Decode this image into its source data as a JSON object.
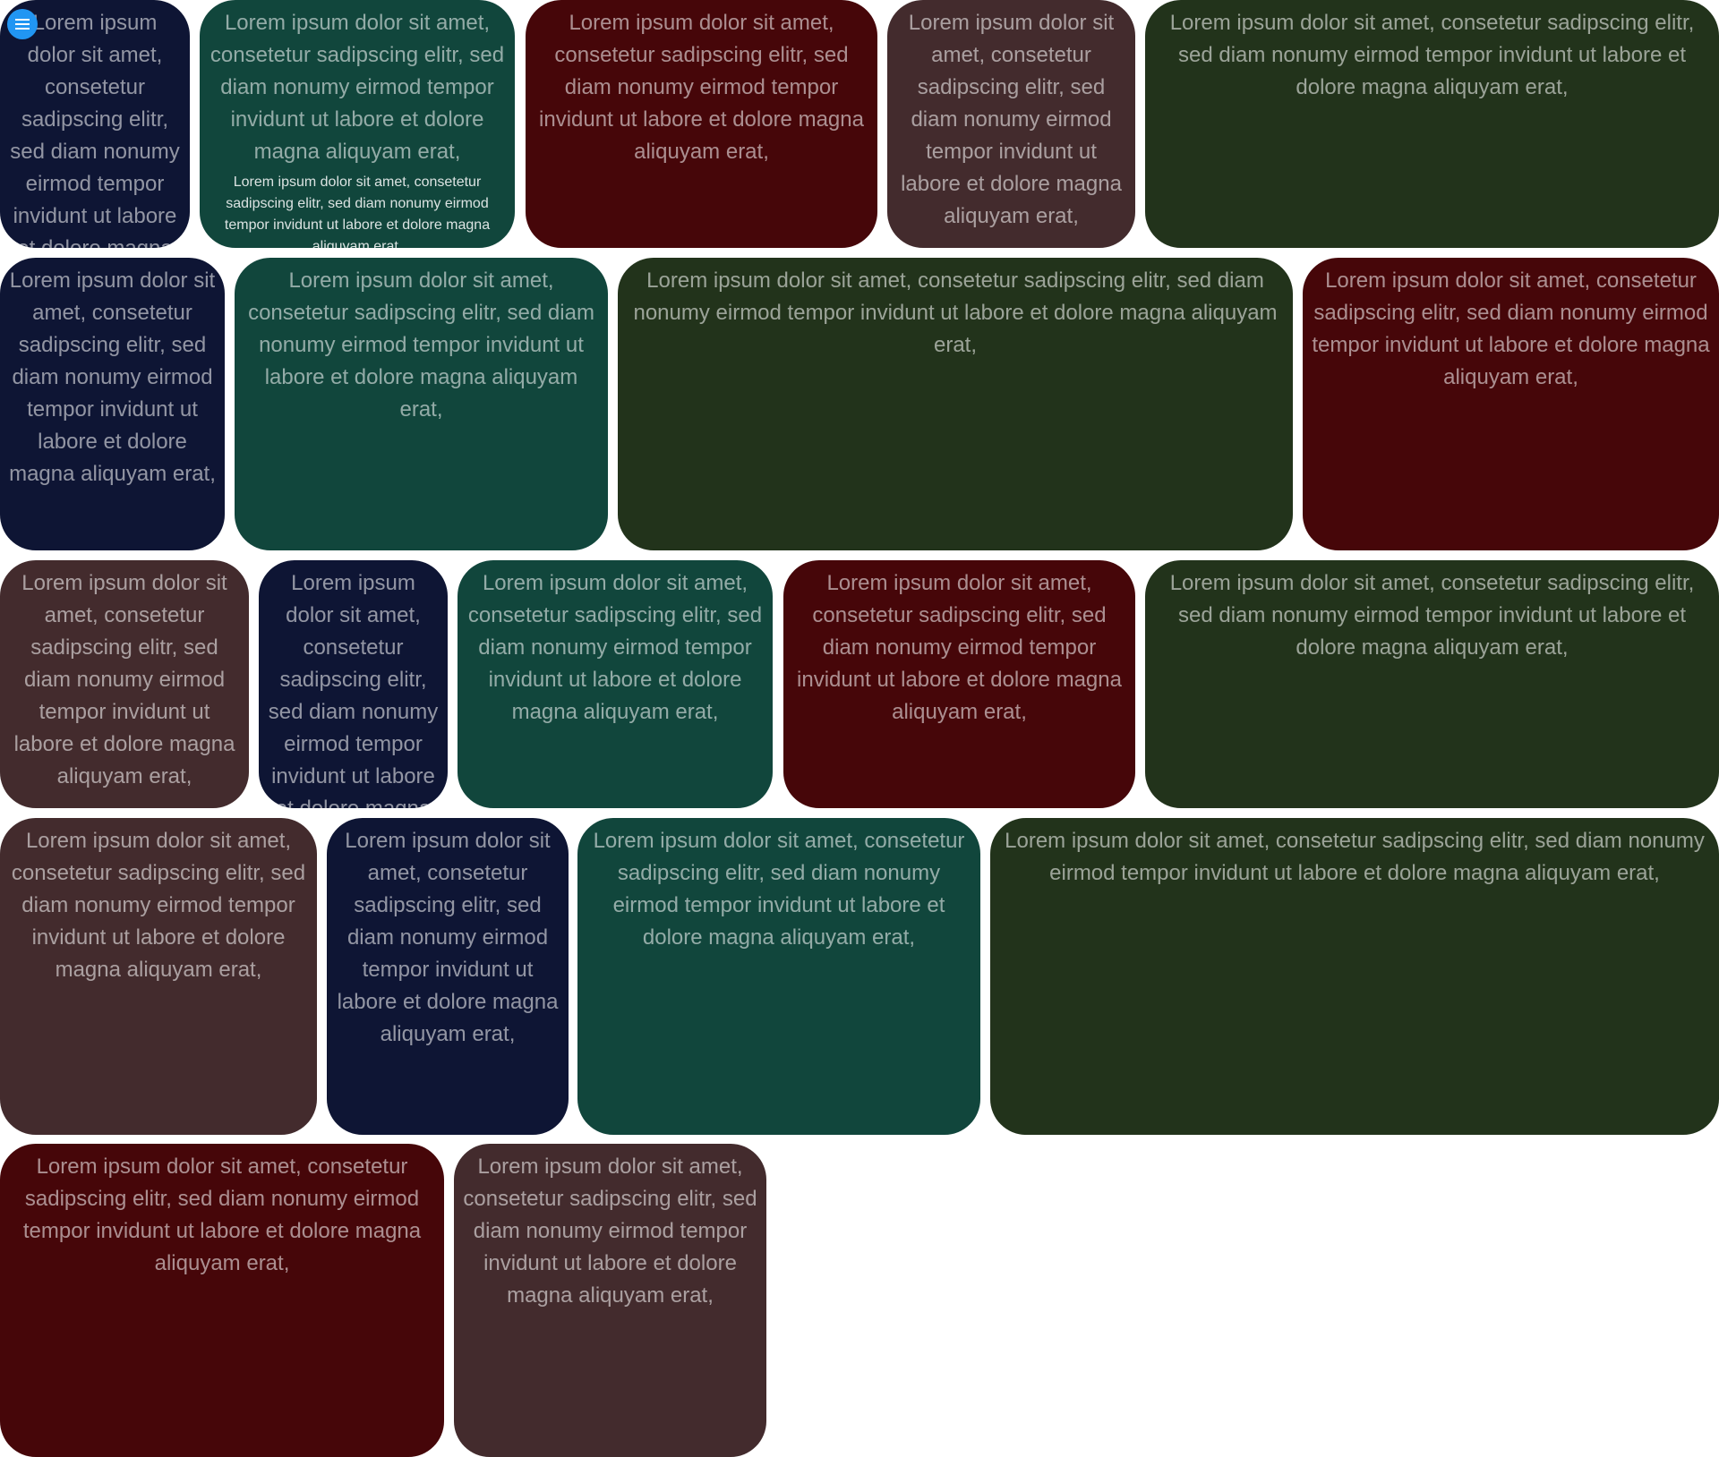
{
  "menu": {
    "icon": "hamburger-menu-icon"
  },
  "colors": {
    "navy": "#0e1534",
    "teal": "#11463c",
    "maroon": "#460609",
    "brown": "#432b2d",
    "olive": "#22331b",
    "menu_button": "#2196f3"
  },
  "tiles": [
    {
      "text": "Lorem ipsum dolor sit amet, consetetur sadipscing elitr, sed diam nonumy eirmod tempor invidunt ut labore et dolore magna aliquyam erat,"
    },
    {
      "text": "Lorem ipsum dolor sit amet, consetetur sadipscing elitr, sed diam nonumy eirmod tempor invidunt ut labore et dolore magna aliquyam erat,",
      "subtext": "Lorem ipsum dolor sit amet, consetetur sadipscing elitr, sed diam nonumy eirmod tempor invidunt ut labore et dolore magna aliquyam erat,"
    },
    {
      "text": "Lorem ipsum dolor sit amet, consetetur sadipscing elitr, sed diam nonumy eirmod tempor invidunt ut labore et dolore magna aliquyam erat,"
    },
    {
      "text": "Lorem ipsum dolor sit amet, consetetur sadipscing elitr, sed diam nonumy eirmod tempor invidunt ut labore et dolore magna aliquyam erat,"
    },
    {
      "text": "Lorem ipsum dolor sit amet, consetetur sadipscing elitr, sed diam nonumy eirmod tempor invidunt ut labore et dolore magna aliquyam erat,"
    },
    {
      "text": "Lorem ipsum dolor sit amet, consetetur sadipscing elitr, sed diam nonumy eirmod tempor invidunt ut labore et dolore magna aliquyam erat,"
    },
    {
      "text": "Lorem ipsum dolor sit amet, consetetur sadipscing elitr, sed diam nonumy eirmod tempor invidunt ut labore et dolore magna aliquyam erat,"
    },
    {
      "text": "Lorem ipsum dolor sit amet, consetetur sadipscing elitr, sed diam nonumy eirmod tempor invidunt ut labore et dolore magna aliquyam erat,"
    },
    {
      "text": "Lorem ipsum dolor sit amet, consetetur sadipscing elitr, sed diam nonumy eirmod tempor invidunt ut labore et dolore magna aliquyam erat,"
    },
    {
      "text": "Lorem ipsum dolor sit amet, consetetur sadipscing elitr, sed diam nonumy eirmod tempor invidunt ut labore et dolore magna aliquyam erat,"
    },
    {
      "text": "Lorem ipsum dolor sit amet, consetetur sadipscing elitr, sed diam nonumy eirmod tempor invidunt ut labore et dolore magna aliquyam erat,"
    },
    {
      "text": "Lorem ipsum dolor sit amet, consetetur sadipscing elitr, sed diam nonumy eirmod tempor invidunt ut labore et dolore magna aliquyam erat,"
    },
    {
      "text": "Lorem ipsum dolor sit amet, consetetur sadipscing elitr, sed diam nonumy eirmod tempor invidunt ut labore et dolore magna aliquyam erat,"
    },
    {
      "text": "Lorem ipsum dolor sit amet, consetetur sadipscing elitr, sed diam nonumy eirmod tempor invidunt ut labore et dolore magna aliquyam erat,"
    },
    {
      "text": "Lorem ipsum dolor sit amet, consetetur sadipscing elitr, sed diam nonumy eirmod tempor invidunt ut labore et dolore magna aliquyam erat,"
    },
    {
      "text": "Lorem ipsum dolor sit amet, consetetur sadipscing elitr, sed diam nonumy eirmod tempor invidunt ut labore et dolore magna aliquyam erat,"
    },
    {
      "text": "Lorem ipsum dolor sit amet, consetetur sadipscing elitr, sed diam nonumy eirmod tempor invidunt ut labore et dolore magna aliquyam erat,"
    },
    {
      "text": "Lorem ipsum dolor sit amet, consetetur sadipscing elitr, sed diam nonumy eirmod tempor invidunt ut labore et dolore magna aliquyam erat,"
    },
    {
      "text": "Lorem ipsum dolor sit amet, consetetur sadipscing elitr, sed diam nonumy eirmod tempor invidunt ut labore et dolore magna aliquyam erat,"
    },
    {
      "text": "Lorem ipsum dolor sit amet, consetetur sadipscing elitr, sed diam nonumy eirmod tempor invidunt ut labore et dolore magna aliquyam erat,"
    },
    {
      "text": "Lorem ipsum dolor sit amet, consetetur sadipscing elitr, sed diam nonumy eirmod tempor invidunt ut labore et dolore magna aliquyam erat,"
    },
    {
      "text": "Lorem ipsum dolor sit amet, consetetur sadipscing elitr, sed diam nonumy eirmod tempor invidunt ut labore et dolore magna aliquyam erat,"
    }
  ]
}
